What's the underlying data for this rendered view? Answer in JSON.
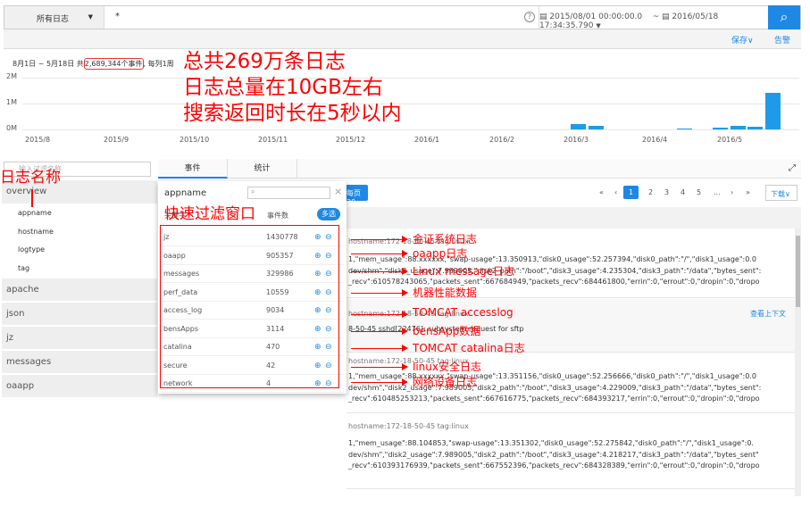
{
  "search": {
    "log_select": "所有日志",
    "query": "*",
    "help_icon": "?",
    "date_from": "2015/08/01 00:00:00.0",
    "date_sep": "~",
    "date_to": "2016/05/18 17:34:35.790",
    "search_icon": "search-icon"
  },
  "toolbar": {
    "save": "保存∨",
    "alert": "告警"
  },
  "summary": {
    "prefix": "8月1日 ~ 5月18日 共",
    "count": "2,689,344个事件",
    "suffix": ", 每列1周"
  },
  "annotations": {
    "line1": "总共269万条日志",
    "line2": "日志总量在10GB左右",
    "line3": "搜索返回时长在5秒以内",
    "log_name": "日志名称",
    "quick_filter": "快速过滤窗口",
    "arrows": [
      "金证系统日志",
      "oaapp日志",
      "Linux message日志",
      "机器性能数据",
      "TOMCAT accesslog",
      "bensApp数据",
      "TOMCAT catalina日志",
      "linux安全日志",
      "网络设备日志"
    ]
  },
  "chart_data": {
    "type": "bar",
    "title": "",
    "xlabel": "",
    "ylabel": "",
    "yticks": [
      "2M",
      "1M",
      "0M"
    ],
    "ylim": [
      0,
      2000000
    ],
    "xticks": [
      "2015/8",
      "2015/9",
      "2015/10",
      "2015/11",
      "2015/12",
      "2016/1",
      "2016/2",
      "2016/3",
      "2016/4",
      "2016/5"
    ],
    "bars": [
      {
        "week": "2016-03-01",
        "value": 210000
      },
      {
        "week": "2016-03-08",
        "value": 150000
      },
      {
        "week": "2016-04-12",
        "value": 30000
      },
      {
        "week": "2016-04-26",
        "value": 70000
      },
      {
        "week": "2016-05-03",
        "value": 150000
      },
      {
        "week": "2016-05-10",
        "value": 100000
      },
      {
        "week": "2016-05-17",
        "value": 1420000
      }
    ]
  },
  "tabs": [
    "事件",
    "统计"
  ],
  "sidebar": {
    "search_placeholder": "输入过滤名称",
    "groups": [
      "overview",
      "apache",
      "json",
      "jz",
      "messages",
      "oaapp"
    ],
    "sub_items": [
      "appname",
      "hostname",
      "logtype",
      "tag"
    ]
  },
  "popup": {
    "title": "appname",
    "header_name": "关键字",
    "header_count": "事件数",
    "multi": "多选",
    "rows": [
      {
        "name": "jz",
        "count": "1430778"
      },
      {
        "name": "oaapp",
        "count": "905357"
      },
      {
        "name": "messages",
        "count": "329986"
      },
      {
        "name": "perf_data",
        "count": "10559"
      },
      {
        "name": "access_log",
        "count": "9034"
      },
      {
        "name": "bensApps",
        "count": "3114"
      },
      {
        "name": "catalina",
        "count": "470"
      },
      {
        "name": "secure",
        "count": "42"
      },
      {
        "name": "network",
        "count": "4"
      }
    ]
  },
  "main": {
    "per_page": "每页20",
    "pages": [
      "«",
      "‹",
      "1",
      "2",
      "3",
      "4",
      "5",
      "...",
      "›",
      "»"
    ],
    "download": "下载∨",
    "context": "查看上下文",
    "events": [
      {
        "meta": "hostname:172-18-50-45        tag:linux",
        "lines": [
          "1,\"mem_usage\":88.xxxxxx,\"swap-usage\":13.350913,\"disk0_usage\":52.257394,\"disk0_path\":\"/\",\"disk1_usage\":0.0",
          "dev/shm\",\"disk2_usage\":7.989005,\"disk2_path\":\"/boot\",\"disk3_usage\":4.235304,\"disk3_path\":\"/data\",\"bytes_sent\":",
          "_recv\":610578243065,\"packets_sent\":667684949,\"packets_recv\":684461800,\"errin\":0,\"errout\":0,\"dropin\":0,\"dropo"
        ]
      },
      {
        "meta": "hostname:172-18-50-45        tag:linux",
        "lines": [
          "8-50-45 sshd[22476]: subsystem request for sftp"
        ]
      },
      {
        "meta": "hostname:172-18-50-45        tag:linux",
        "lines": [
          "1,\"mem_usage\":88.xxxxxx,\"swap-usage\":13.351156,\"disk0_usage\":52.256666,\"disk0_path\":\"/\",\"disk1_usage\":0.0",
          "dev/shm\",\"disk2_usage\":7.989005,\"disk2_path\":\"/boot\",\"disk3_usage\":4.229009,\"disk3_path\":\"/data\",\"bytes_sent\":",
          "_recv\":610485253213,\"packets_sent\":667616775,\"packets_recv\":684393217,\"errin\":0,\"errout\":0,\"dropin\":0,\"dropo"
        ]
      },
      {
        "meta": "hostname:172-18-50-45        tag:linux",
        "lines": [
          "1,\"mem_usage\":88.104853,\"swap-usage\":13.351302,\"disk0_usage\":52.275842,\"disk0_path\":\"/\",\"disk1_usage\":0.",
          "dev/shm\",\"disk2_usage\":7.989005,\"disk2_path\":\"/boot\",\"disk3_usage\":4.218217,\"disk3_path\":\"/data\",\"bytes_sent\"",
          "_recv\":610393176939,\"packets_sent\":667552396,\"packets_recv\":684328389,\"errin\":0,\"errout\":0,\"dropin\":0,\"dropo"
        ]
      }
    ]
  },
  "colors": {
    "accent": "#1e88e5",
    "annotation": "#ff0000",
    "bar": "#1e9be8"
  }
}
